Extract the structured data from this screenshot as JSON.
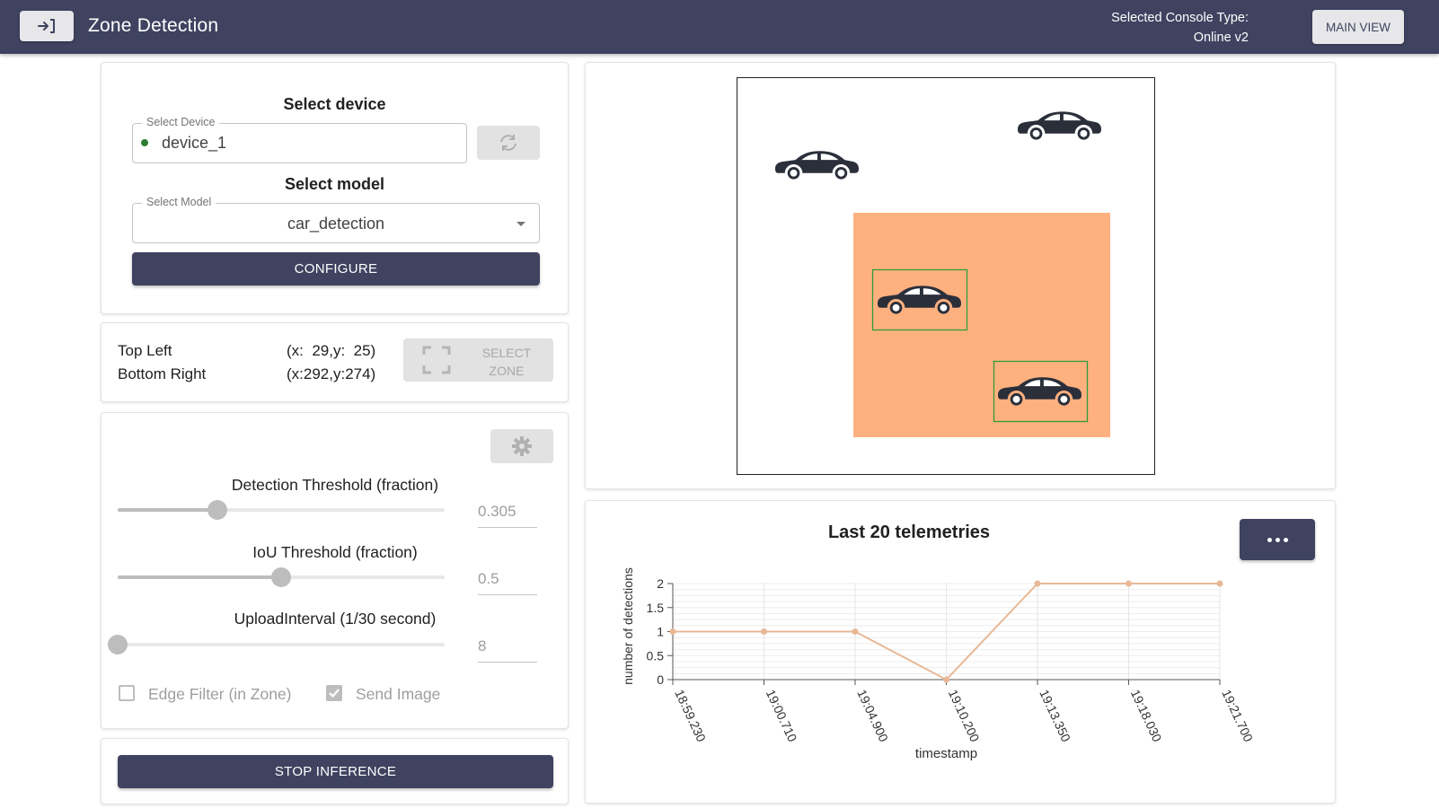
{
  "appbar": {
    "title": "Zone Detection",
    "console_line1": "Selected Console Type:",
    "console_line2": "Online v2",
    "main_view_label": "MAIN VIEW",
    "background": "#3f4360"
  },
  "device": {
    "section_title": "Select device",
    "field_legend": "Select Device",
    "value": "device_1",
    "status_color": "#2e7d32",
    "refresh_icon": "refresh-icon"
  },
  "model": {
    "section_title": "Select model",
    "field_legend": "Select Model",
    "value": "car_detection"
  },
  "configure_label": "CONFIGURE",
  "zone": {
    "top_left_label": "Top Left",
    "top_left_value": "(x:  29,y:  25)",
    "bottom_right_label": "Bottom Right",
    "bottom_right_value": "(x:292,y:274)",
    "select_zone_line1": "SELECT",
    "select_zone_line2": "ZONE"
  },
  "settings": {
    "settings_icon": "gear-icon",
    "detection_threshold": {
      "label": "Detection Threshold (fraction)",
      "value": "0.305",
      "fraction": 0.305
    },
    "iou_threshold": {
      "label": "IoU Threshold (fraction)",
      "value": "0.5",
      "fraction": 0.5
    },
    "upload_interval": {
      "label": "UploadInterval (1/30 second)",
      "value": "8",
      "fraction": 0.0
    },
    "edge_filter": {
      "label": "Edge Filter (in Zone)",
      "checked": false
    },
    "send_image": {
      "label": "Send Image",
      "checked": true
    }
  },
  "stop_inference_label": "STOP INFERENCE",
  "preview": {
    "zone_color": "#ffb07f",
    "detection_box_color": "#2e9e3a",
    "car_color": "#2b2f3a"
  },
  "chart_data": {
    "type": "line",
    "title": "Last 20 telemetries",
    "xlabel": "timestamp",
    "ylabel": "number of detections",
    "x": [
      "18:59.230",
      "19:00.710",
      "19:04.900",
      "19:10.200",
      "19:13.350",
      "19:18.030",
      "19:21.700"
    ],
    "series": [
      {
        "values": [
          1,
          1,
          1,
          0,
          2,
          2,
          2
        ]
      }
    ],
    "ylim": [
      0,
      2
    ],
    "yticks": [
      "0",
      "0.5",
      "1",
      "1.5",
      "2"
    ],
    "grid": true,
    "line_color": "#e8b896"
  }
}
